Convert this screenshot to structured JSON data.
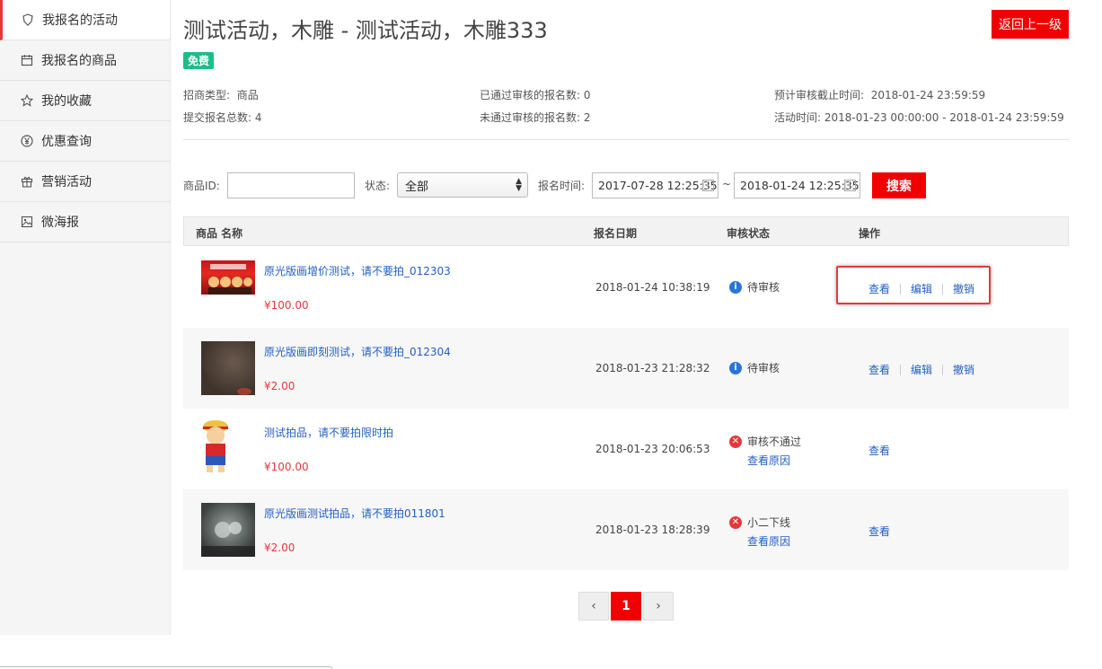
{
  "sidebar": {
    "items": [
      {
        "label": "我报名的活动",
        "icon": "badge-icon",
        "active": true
      },
      {
        "label": "我报名的商品",
        "icon": "calendar-icon",
        "active": false
      },
      {
        "label": "我的收藏",
        "icon": "star-icon",
        "active": false
      },
      {
        "label": "优惠查询",
        "icon": "yen-icon",
        "active": false
      },
      {
        "label": "营销活动",
        "icon": "gift-icon",
        "active": false
      },
      {
        "label": "微海报",
        "icon": "image-icon",
        "active": false
      }
    ]
  },
  "header": {
    "title": "测试活动，木雕 - 测试活动，木雕333",
    "back_label": "返回上一级",
    "badge": "免费"
  },
  "info": {
    "type_label": "招商类型:",
    "type_value": "商品",
    "total_label": "提交报名总数:",
    "total_value": "4",
    "passed_label": "已通过审核的报名数:",
    "passed_value": "0",
    "failed_label": "未通过审核的报名数:",
    "failed_value": "2",
    "deadline_label": "预计审核截止时间:",
    "deadline_value": "2018-01-24 23:59:59",
    "period_label": "活动时间:",
    "period_value": "2018-01-23 00:00:00 - 2018-01-24 23:59:59"
  },
  "filter": {
    "id_label": "商品ID:",
    "id_value": "",
    "status_label": "状态:",
    "status_value": "全部",
    "time_label": "报名时间:",
    "start": "2017-07-28 12:25:35",
    "tilde": "~",
    "end": "2018-01-24 12:25:35",
    "search_label": "搜索"
  },
  "table": {
    "headers": [
      "商品 名称",
      "报名日期",
      "审核状态",
      "操作"
    ],
    "rows": [
      {
        "name": "原光版画增价测试，请不要拍_012303",
        "price": "¥100.00",
        "date": "2018-01-24 10:38:19",
        "status": "待审核",
        "status_type": "info",
        "ops": [
          "查看",
          "编辑",
          "撤销"
        ]
      },
      {
        "name": "原光版画即刻测试，请不要拍_012304",
        "price": "¥2.00",
        "date": "2018-01-23 21:28:32",
        "status": "待审核",
        "status_type": "info",
        "ops": [
          "查看",
          "编辑",
          "撤销"
        ]
      },
      {
        "name": "测试拍品，请不要拍限时拍",
        "price": "¥100.00",
        "date": "2018-01-23 20:06:53",
        "status": "审核不通过",
        "status_type": "error",
        "reason": "查看原因",
        "ops": [
          "查看"
        ]
      },
      {
        "name": "原光版画测试拍品，请不要拍011801",
        "price": "¥2.00",
        "date": "2018-01-23 18:28:39",
        "status": "小二下线",
        "status_type": "error",
        "reason": "查看原因",
        "ops": [
          "查看"
        ]
      }
    ]
  },
  "pagination": {
    "prev": "‹",
    "current": "1",
    "next": "›"
  },
  "colors": {
    "accent": "#f10000",
    "link": "#2460c2",
    "badge": "#1ebc8a",
    "info": "#2b74d8"
  }
}
